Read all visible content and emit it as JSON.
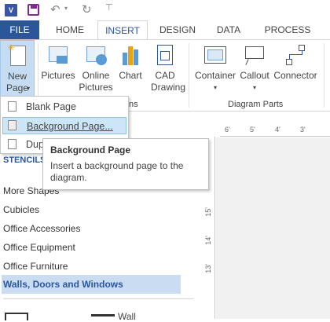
{
  "ribbon_tabs": {
    "file": "FILE",
    "home": "HOME",
    "insert": "INSERT",
    "design": "DESIGN",
    "data": "DATA",
    "process": "PROCESS"
  },
  "ribbon": {
    "new_page": "New Page",
    "pictures": "Pictures",
    "online_pictures": "Online Pictures",
    "chart": "Chart",
    "cad_drawing": "CAD Drawing",
    "container": "Container",
    "callout": "Callout",
    "connector": "Connector",
    "group_illustrations_tail": "ns",
    "group_diagram_parts": "Diagram Parts"
  },
  "dropdown": {
    "items": [
      {
        "label": "Blank Page"
      },
      {
        "label": "Background Page..."
      },
      {
        "label": "Dup"
      }
    ]
  },
  "tooltip": {
    "title": "Background Page",
    "description": "Insert a background page to the diagram."
  },
  "shapes_pane": {
    "stencils_header": "STENCILS",
    "more_shapes": "More Shapes",
    "stencils": [
      {
        "label": "Cubicles"
      },
      {
        "label": "Office Accessories"
      },
      {
        "label": "Office Equipment"
      },
      {
        "label": "Office Furniture"
      },
      {
        "label": "Walls, Doors and Windows"
      }
    ],
    "bottom_partial": "Wall"
  },
  "ruler": {
    "top_ticks": [
      "6'",
      "5'",
      "4'",
      "3'"
    ],
    "left_ticks": [
      "15'",
      "14'",
      "13'"
    ]
  },
  "colors": {
    "file_tab": "#2b579a",
    "selected_stencil": "#c9dcf2",
    "dropdown_highlight": "#cde6f7"
  }
}
